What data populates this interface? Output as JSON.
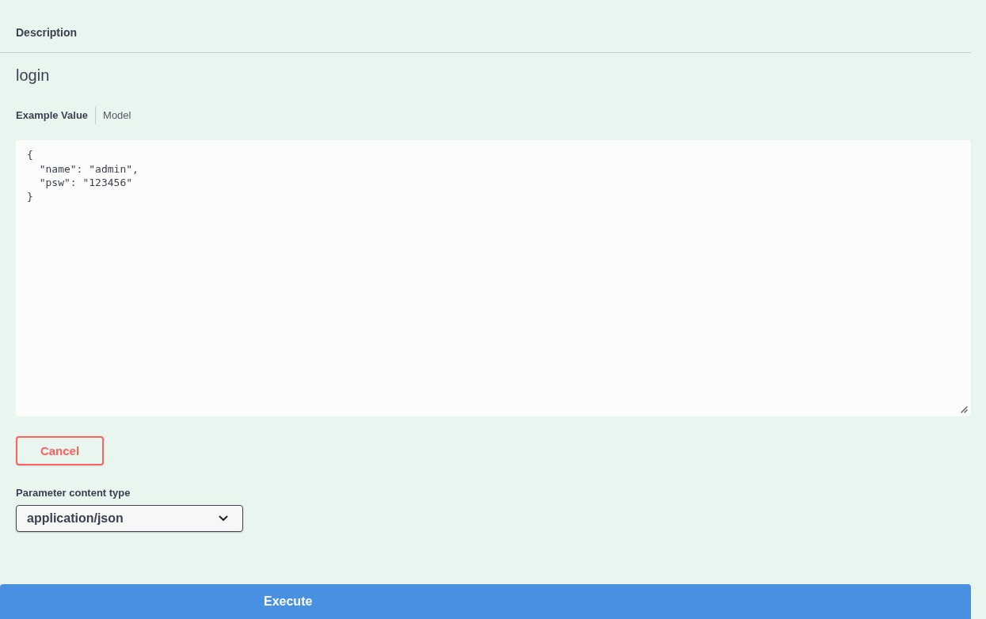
{
  "description_header": "Description",
  "description": "login",
  "example_tabs": [
    {
      "label": "Example Value",
      "selected": true
    },
    {
      "label": "Model",
      "selected": false
    }
  ],
  "body_editor": {
    "value": "{\n  \"name\": \"admin\",\n  \"psw\": \"123456\"\n}"
  },
  "cancel_button": "Cancel",
  "content_type": {
    "label": "Parameter content type",
    "value": "application/json"
  },
  "execute_button": "Execute"
}
